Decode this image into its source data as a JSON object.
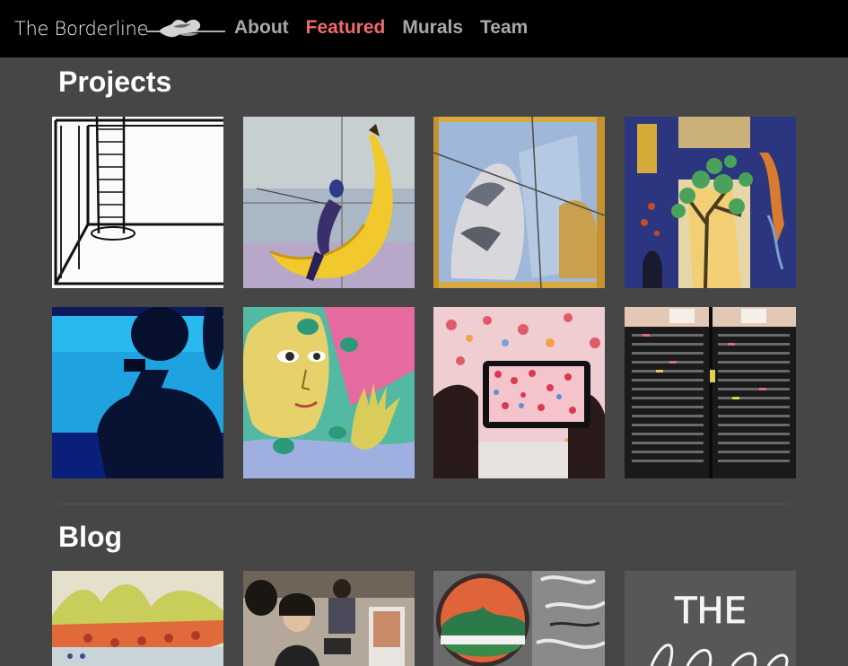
{
  "navbar": {
    "brand": "The Borderline",
    "links": [
      {
        "label": "About",
        "active": false
      },
      {
        "label": "Featured",
        "active": true
      },
      {
        "label": "Murals",
        "active": false
      },
      {
        "label": "Team",
        "active": false
      }
    ]
  },
  "projects": {
    "title": "Projects"
  },
  "blog": {
    "title": "Blog",
    "tile4_text": "THE"
  },
  "colors": {
    "background": "#464646",
    "navbar": "#000000",
    "active_link": "#f06a6e",
    "inactive_link": "#a8a8a8"
  }
}
